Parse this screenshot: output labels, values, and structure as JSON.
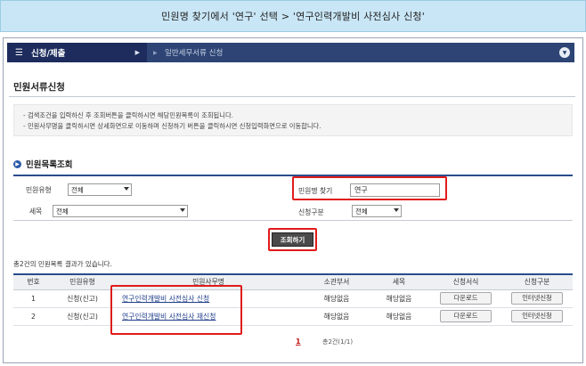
{
  "banner": {
    "text": "민원명 찾기에서 '연구' 선택 > '연구인력개발비 사전심사 신청'"
  },
  "nav": {
    "menu_icon": "hamburger-icon",
    "main_label": "신청/제출",
    "sub_label": "일반세무서류 신청"
  },
  "page": {
    "title": "민원서류신청"
  },
  "notice": {
    "lines": [
      "- 검색조건을 입력하신 후 조회버튼을 클릭하시면 해당민원목록이 조회됩니다.",
      "- 민원사무명을 클릭하시면 상세화면으로 이동하며  신청하기 버튼을 클릭하시면 신청입력화면으로 이동합니다."
    ]
  },
  "search": {
    "section_title": "민원목록조회",
    "type_label": "민원유형",
    "type_value": "전체",
    "tax_label": "세목",
    "tax_value": "전체",
    "name_label": "민원명 찾기",
    "name_value": "연구",
    "apply_label": "신청구분",
    "apply_value": "전체",
    "button_label": "조회하기"
  },
  "results": {
    "count_text": "총2건의 민원목록 결과가 있습니다.",
    "columns": [
      "번호",
      "민원유형",
      "민원사무명",
      "소관부서",
      "세목",
      "신청서식",
      "신청구분"
    ],
    "rows": [
      {
        "no": "1",
        "type": "신청(신고)",
        "name": "연구인력개발비 사전심사 신청",
        "dept": "해당없음",
        "tax": "해당없음",
        "form": "다운로드",
        "apply": "인터넷신청"
      },
      {
        "no": "2",
        "type": "신청(신고)",
        "name": "연구인력개발비 사전심사 재신청",
        "dept": "해당없음",
        "tax": "해당없음",
        "form": "다운로드",
        "apply": "인터넷신청"
      }
    ]
  },
  "pagination": {
    "current": "1",
    "summary": "총2건(1/1)"
  },
  "colors": {
    "highlight": "#e01b1b",
    "nav_dark": "#1d2c5c",
    "banner": "#c9e6f6"
  }
}
